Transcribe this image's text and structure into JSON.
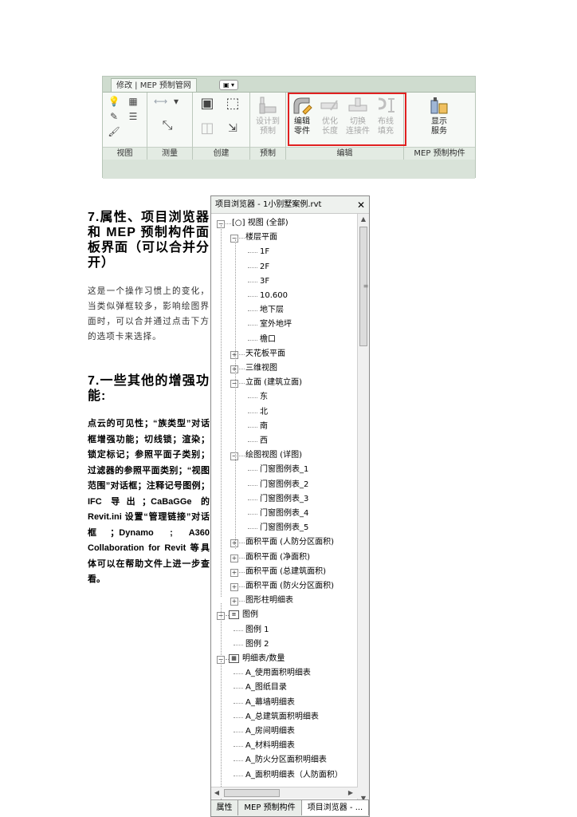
{
  "ribbon": {
    "tab_label": "修改 | MEP 预制管网",
    "qat_symbol": "▣ ▾",
    "panels": [
      {
        "label": "视图"
      },
      {
        "label": "测量"
      },
      {
        "label": "创建"
      },
      {
        "label": "预制",
        "tools": [
          {
            "label_line1": "设计到",
            "label_line2": "预制",
            "icon": "design-to-fabrication-icon",
            "enabled": false
          }
        ]
      },
      {
        "label": "编辑",
        "tools": [
          {
            "label_line1": "编辑",
            "label_line2": "零件",
            "icon": "edit-part-icon",
            "enabled": true
          },
          {
            "label_line1": "优化",
            "label_line2": "长度",
            "icon": "optimize-length-icon",
            "enabled": false
          },
          {
            "label_line1": "切换",
            "label_line2": "连接件",
            "icon": "switch-connector-icon",
            "enabled": false
          },
          {
            "label_line1": "布线",
            "label_line2": "填充",
            "icon": "route-fill-icon",
            "enabled": false
          }
        ]
      },
      {
        "label": "MEP 预制构件",
        "tools": [
          {
            "label_line1": "显示",
            "label_line2": "服务",
            "icon": "show-service-icon",
            "enabled": true
          }
        ]
      }
    ],
    "highlight_color": "#e02020"
  },
  "left_text": {
    "heading1": "7.属性、项目浏览器和 MEP 预制构件面板界面（可以合并分开）",
    "para1": "这是一个操作习惯上的变化，当类似弹框较多，影响绘图界面时，可以合并通过点击下方的选项卡来选择。",
    "heading2": "7.一些其他的增强功能:",
    "para2": "点云的可见性；“族类型”对话框增强功能；切线锁；渲染；锁定标记；参照平面子类别；过滤器的参照平面类别；“视图范围”对话框；注释记号图例；IFC 导出；CaBaGGe 的 Revit.ini 设置“管理链接”对话框；Dynamo ; A360 Collaboration for Revit 等具体可以在帮助文件上进一步查看。"
  },
  "project_browser": {
    "title": "项目浏览器 - 1小别墅案例.rvt",
    "close_symbol": "✕",
    "tree": [
      {
        "label": "[○] 视图 (全部)",
        "level": 0,
        "expander": "−"
      },
      {
        "label": "楼层平面",
        "level": 1,
        "expander": "−"
      },
      {
        "label": "1F",
        "level": 2
      },
      {
        "label": "2F",
        "level": 2
      },
      {
        "label": "3F",
        "level": 2
      },
      {
        "label": "10.600",
        "level": 2
      },
      {
        "label": "地下层",
        "level": 2
      },
      {
        "label": "室外地坪",
        "level": 2
      },
      {
        "label": "檐口",
        "level": 2
      },
      {
        "label": "天花板平面",
        "level": 1,
        "expander": "+"
      },
      {
        "label": "三维视图",
        "level": 1,
        "expander": "+"
      },
      {
        "label": "立面 (建筑立面)",
        "level": 1,
        "expander": "−"
      },
      {
        "label": "东",
        "level": 2
      },
      {
        "label": "北",
        "level": 2
      },
      {
        "label": "南",
        "level": 2
      },
      {
        "label": "西",
        "level": 2
      },
      {
        "label": "绘图视图 (详图)",
        "level": 1,
        "expander": "−"
      },
      {
        "label": "门窗图例表_1",
        "level": 2
      },
      {
        "label": "门窗图例表_2",
        "level": 2
      },
      {
        "label": "门窗图例表_3",
        "level": 2
      },
      {
        "label": "门窗图例表_4",
        "level": 2
      },
      {
        "label": "门窗图例表_5",
        "level": 2
      },
      {
        "label": "面积平面 (人防分区面积)",
        "level": 1,
        "expander": "+"
      },
      {
        "label": "面积平面 (净面积)",
        "level": 1,
        "expander": "+"
      },
      {
        "label": "面积平面 (总建筑面积)",
        "level": 1,
        "expander": "+"
      },
      {
        "label": "面积平面 (防火分区面积)",
        "level": 1,
        "expander": "+"
      },
      {
        "label": "图形柱明细表",
        "level": 1,
        "expander": "+"
      },
      {
        "label": "图例",
        "level": 0,
        "expander": "−",
        "icon": "legend-icon"
      },
      {
        "label": "图例 1",
        "level": 1
      },
      {
        "label": "图例 2",
        "level": 1
      },
      {
        "label": "明细表/数量",
        "level": 0,
        "expander": "−",
        "icon": "schedule-icon"
      },
      {
        "label": "A_使用面积明细表",
        "level": 1
      },
      {
        "label": "A_图纸目录",
        "level": 1
      },
      {
        "label": "A_幕墙明细表",
        "level": 1
      },
      {
        "label": "A_总建筑面积明细表",
        "level": 1
      },
      {
        "label": "A_房间明细表",
        "level": 1
      },
      {
        "label": "A_材料明细表",
        "level": 1
      },
      {
        "label": "A_防火分区面积明细表",
        "level": 1
      },
      {
        "label": "A_面积明细表（人防面积）",
        "level": 1
      }
    ],
    "tabs": [
      {
        "label": "属性",
        "active": false
      },
      {
        "label": "MEP 预制构件",
        "active": false
      },
      {
        "label": "项目浏览器 - ...",
        "active": true
      }
    ]
  }
}
